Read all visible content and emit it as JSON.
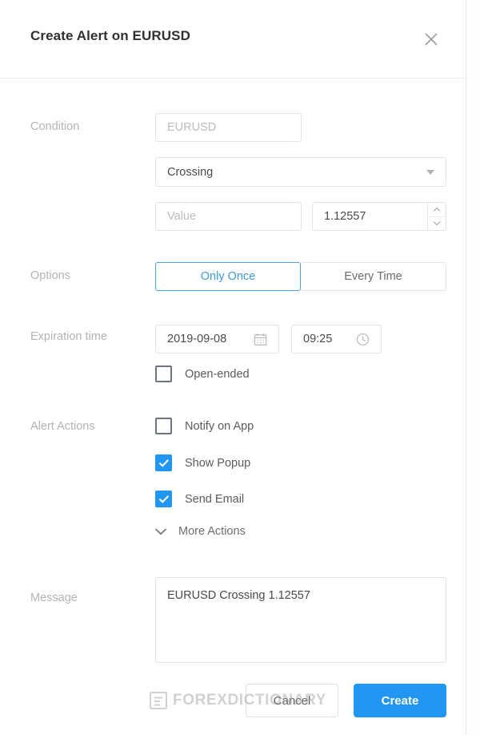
{
  "dialog": {
    "title": "Create Alert on EURUSD",
    "close_icon": "close-icon"
  },
  "condition": {
    "label": "Condition",
    "symbol_placeholder": "EURUSD",
    "operator_value": "Crossing",
    "value_placeholder": "Value",
    "price_value": "1.12557"
  },
  "options": {
    "label": "Options",
    "only_once": "Only Once",
    "every_time": "Every Time",
    "selected": "Only Once"
  },
  "expiration": {
    "label": "Expiration time",
    "date_value": "2019-09-08",
    "time_value": "09:25",
    "open_ended_label": "Open-ended",
    "open_ended_checked": false
  },
  "alert_actions": {
    "label": "Alert Actions",
    "items": [
      {
        "label": "Notify on App",
        "checked": false
      },
      {
        "label": "Show Popup",
        "checked": true
      },
      {
        "label": "Send Email",
        "checked": true
      }
    ],
    "more_actions_label": "More Actions"
  },
  "message": {
    "label": "Message",
    "value": "EURUSD Crossing 1.12557"
  },
  "footer": {
    "cancel_label": "Cancel",
    "create_label": "Create"
  },
  "watermark": {
    "text": "FOREXDICTIONARY"
  },
  "colors": {
    "accent": "#2196f3",
    "selected_border": "#4aa3df",
    "label_gray": "#b4b4b4",
    "field_border": "#e4e4e4"
  }
}
